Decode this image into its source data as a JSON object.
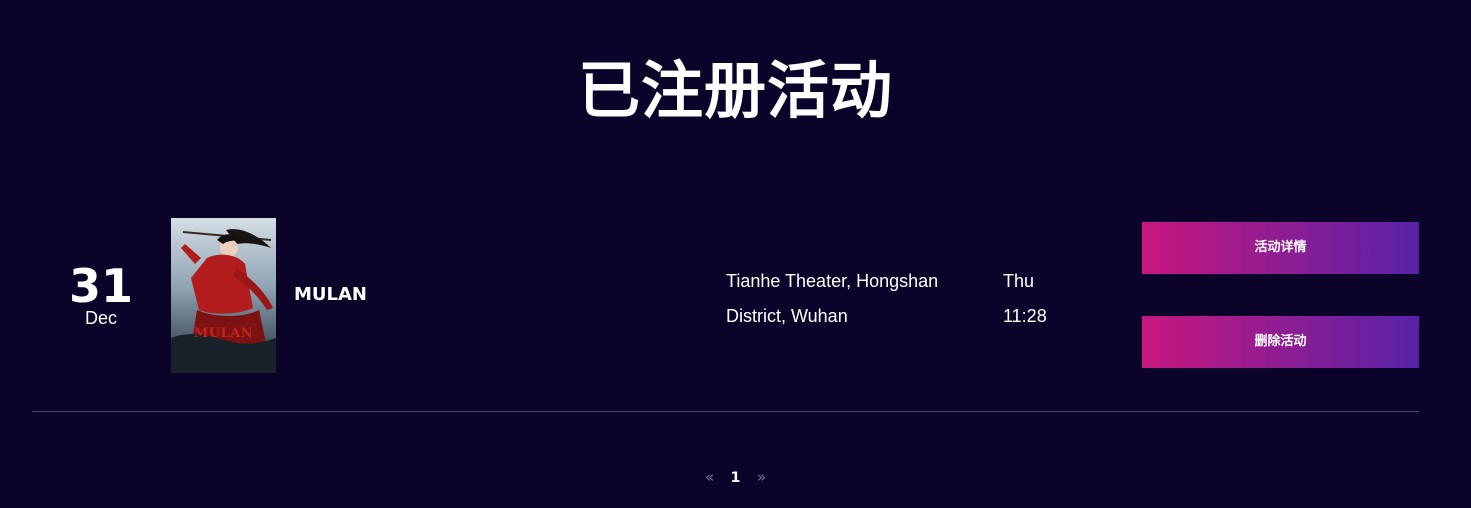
{
  "page": {
    "title": "已注册活动"
  },
  "event": {
    "day": "31",
    "month": "Dec",
    "poster_title": "MULAN",
    "name": "MULAN",
    "location": "Tianhe Theater, Hongshan District, Wuhan",
    "weekday": "Thu",
    "time": "11:28",
    "detail_button": "活动详情",
    "delete_button": "删除活动"
  },
  "pagination": {
    "prev": "«",
    "current": "1",
    "next": "»"
  },
  "colors": {
    "background": "#0b0329",
    "button_gradient_start": "#c8177e",
    "button_gradient_end": "#5723a8",
    "divider": "#4a4268"
  }
}
